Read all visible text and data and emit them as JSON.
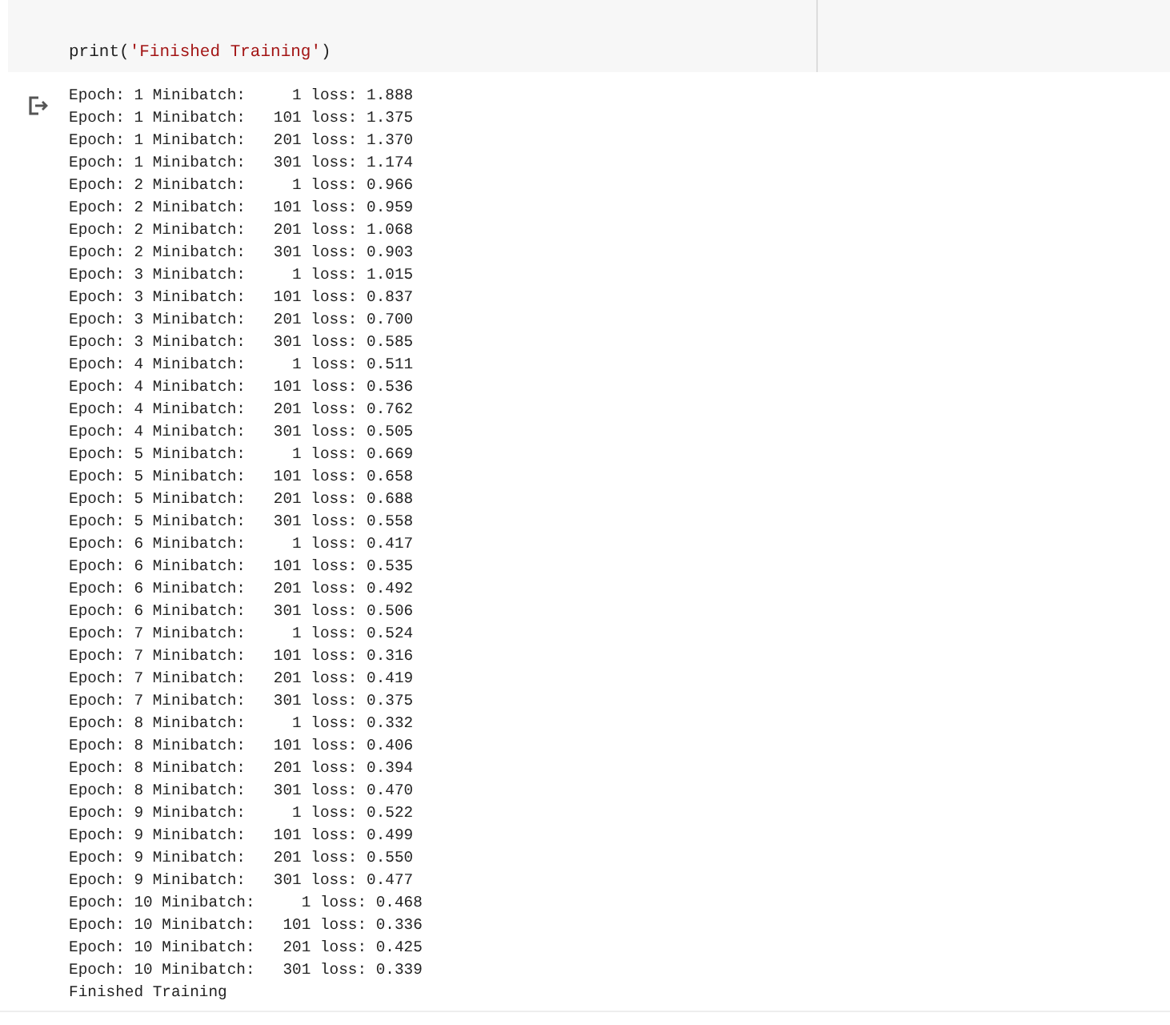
{
  "code_cell": {
    "tokens": [
      {
        "kind": "plain",
        "text": "print("
      },
      {
        "kind": "string",
        "text": "'Finished Training'"
      },
      {
        "kind": "plain",
        "text": ")"
      }
    ]
  },
  "output": {
    "lines": [
      "Epoch: 1 Minibatch:     1 loss: 1.888",
      "Epoch: 1 Minibatch:   101 loss: 1.375",
      "Epoch: 1 Minibatch:   201 loss: 1.370",
      "Epoch: 1 Minibatch:   301 loss: 1.174",
      "Epoch: 2 Minibatch:     1 loss: 0.966",
      "Epoch: 2 Minibatch:   101 loss: 0.959",
      "Epoch: 2 Minibatch:   201 loss: 1.068",
      "Epoch: 2 Minibatch:   301 loss: 0.903",
      "Epoch: 3 Minibatch:     1 loss: 1.015",
      "Epoch: 3 Minibatch:   101 loss: 0.837",
      "Epoch: 3 Minibatch:   201 loss: 0.700",
      "Epoch: 3 Minibatch:   301 loss: 0.585",
      "Epoch: 4 Minibatch:     1 loss: 0.511",
      "Epoch: 4 Minibatch:   101 loss: 0.536",
      "Epoch: 4 Minibatch:   201 loss: 0.762",
      "Epoch: 4 Minibatch:   301 loss: 0.505",
      "Epoch: 5 Minibatch:     1 loss: 0.669",
      "Epoch: 5 Minibatch:   101 loss: 0.658",
      "Epoch: 5 Minibatch:   201 loss: 0.688",
      "Epoch: 5 Minibatch:   301 loss: 0.558",
      "Epoch: 6 Minibatch:     1 loss: 0.417",
      "Epoch: 6 Minibatch:   101 loss: 0.535",
      "Epoch: 6 Minibatch:   201 loss: 0.492",
      "Epoch: 6 Minibatch:   301 loss: 0.506",
      "Epoch: 7 Minibatch:     1 loss: 0.524",
      "Epoch: 7 Minibatch:   101 loss: 0.316",
      "Epoch: 7 Minibatch:   201 loss: 0.419",
      "Epoch: 7 Minibatch:   301 loss: 0.375",
      "Epoch: 8 Minibatch:     1 loss: 0.332",
      "Epoch: 8 Minibatch:   101 loss: 0.406",
      "Epoch: 8 Minibatch:   201 loss: 0.394",
      "Epoch: 8 Minibatch:   301 loss: 0.470",
      "Epoch: 9 Minibatch:     1 loss: 0.522",
      "Epoch: 9 Minibatch:   101 loss: 0.499",
      "Epoch: 9 Minibatch:   201 loss: 0.550",
      "Epoch: 9 Minibatch:   301 loss: 0.477",
      "Epoch: 10 Minibatch:     1 loss: 0.468",
      "Epoch: 10 Minibatch:   101 loss: 0.336",
      "Epoch: 10 Minibatch:   201 loss: 0.425",
      "Epoch: 10 Minibatch:   301 loss: 0.339",
      "Finished Training"
    ]
  }
}
